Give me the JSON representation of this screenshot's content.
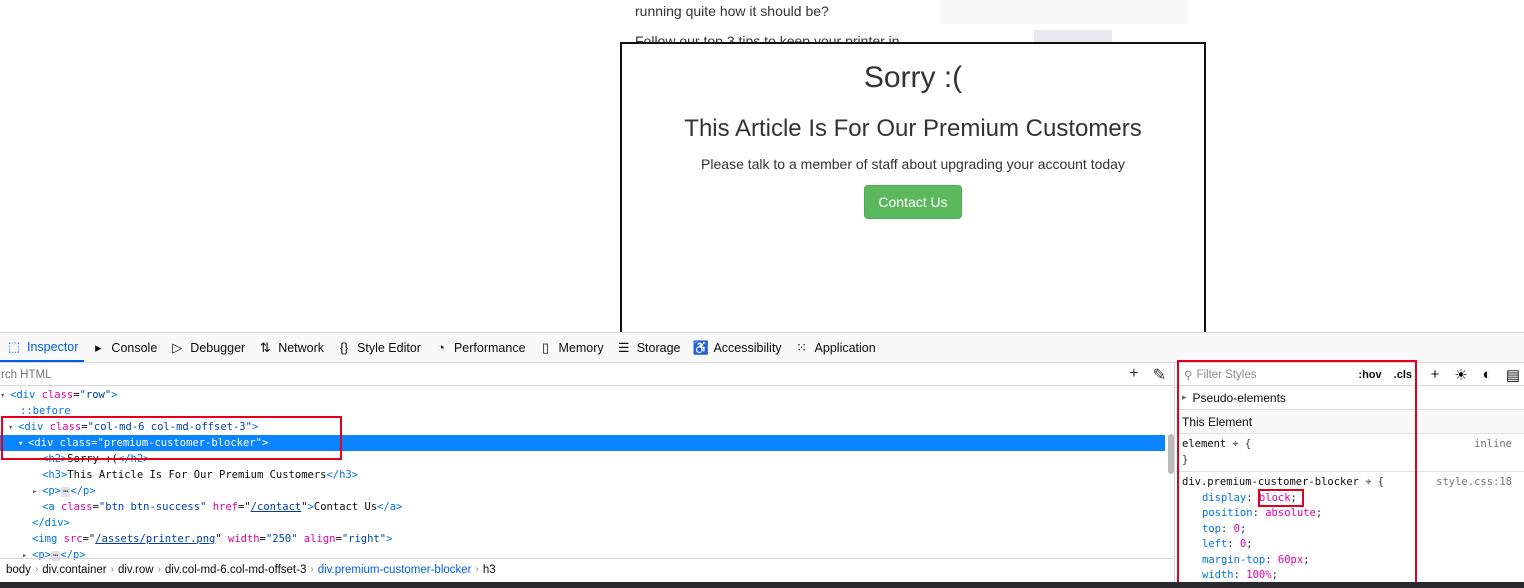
{
  "page": {
    "article_line1": "running quite how it should be?",
    "article_line2": "Follow our top 3 tips to keep your printer in",
    "blocker_title": "Sorry :(",
    "blocker_heading": "This Article Is For Our Premium Customers",
    "blocker_text": "Please talk to a member of staff about upgrading your account today",
    "contact_button": "Contact Us"
  },
  "devtools": {
    "tabs": [
      {
        "label": "Inspector",
        "icon": "inspector-icon"
      },
      {
        "label": "Console",
        "icon": "console-icon"
      },
      {
        "label": "Debugger",
        "icon": "debugger-icon"
      },
      {
        "label": "Network",
        "icon": "network-icon"
      },
      {
        "label": "Style Editor",
        "icon": "style-editor-icon"
      },
      {
        "label": "Performance",
        "icon": "performance-icon"
      },
      {
        "label": "Memory",
        "icon": "memory-icon"
      },
      {
        "label": "Storage",
        "icon": "storage-icon"
      },
      {
        "label": "Accessibility",
        "icon": "accessibility-icon"
      },
      {
        "label": "Application",
        "icon": "application-icon"
      }
    ],
    "search_placeholder": "rch HTML",
    "tree": {
      "row_div": "div",
      "row_class": "class",
      "row_val": "\"row\"",
      "before": "::before",
      "col_val": "\"col-md-6 col-md-offset-3\"",
      "blocker_val": "\"premium-customer-blocker\"",
      "h2_text": "Sorry :(",
      "h3_text": "This Article Is For Our Premium Customers",
      "a_class_val": "\"btn btn-success\"",
      "a_href_val": "/contact",
      "a_text": "Contact Us",
      "img_src_val": "/assets/printer.png",
      "img_width_val": "\"250\"",
      "img_align_val": "\"right\""
    },
    "breadcrumbs": [
      "body",
      "div.container",
      "div.row",
      "div.col-md-6.col-md-offset-3",
      "div.premium-customer-blocker",
      "h3"
    ],
    "rules": {
      "filter_placeholder": "Filter Styles",
      "hov": ":hov",
      "cls": ".cls",
      "pseudo_elements": "Pseudo-elements",
      "this_element": "This Element",
      "element_selector": "element",
      "element_source": "inline",
      "rule_selector": "div.premium-customer-blocker",
      "rule_source": "style.css:18",
      "props": [
        {
          "name": "display",
          "value": "block"
        },
        {
          "name": "position",
          "value": "absolute"
        },
        {
          "name": "top",
          "value": "0"
        },
        {
          "name": "left",
          "value": "0"
        },
        {
          "name": "margin-top",
          "value": "60px"
        },
        {
          "name": "width",
          "value": "100%"
        }
      ]
    }
  },
  "colors": {
    "accent": "#0060df",
    "selection": "#0a84ff",
    "button_success": "#5cb85c",
    "highlight_box": "#e2001a"
  }
}
